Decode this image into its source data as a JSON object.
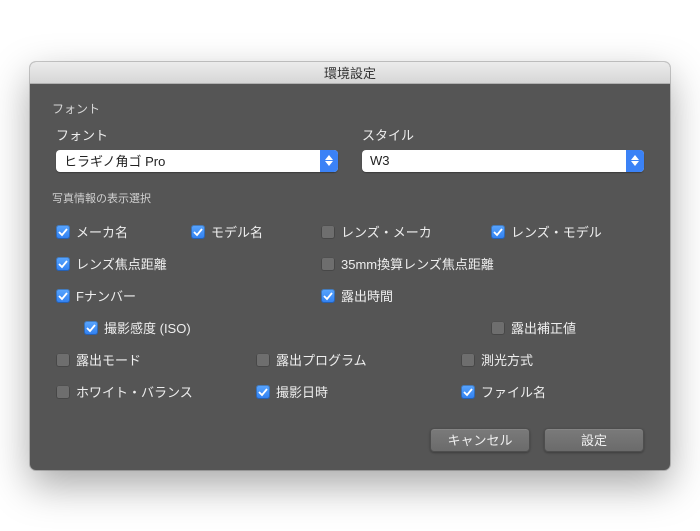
{
  "title": "環境設定",
  "fontSection": {
    "groupLabel": "フォント",
    "fontLabel": "フォント",
    "styleLabel": "スタイル",
    "fontValue": "ヒラギノ角ゴ Pro",
    "styleValue": "W3"
  },
  "displaySection": {
    "label": "写真情報の表示選択",
    "items": {
      "maker": {
        "label": "メーカ名",
        "checked": true
      },
      "model": {
        "label": "モデル名",
        "checked": true
      },
      "lensMaker": {
        "label": "レンズ・メーカ",
        "checked": false
      },
      "lensModel": {
        "label": "レンズ・モデル",
        "checked": true
      },
      "focalLength": {
        "label": "レンズ焦点距離",
        "checked": true
      },
      "focal35mm": {
        "label": "35mm換算レンズ焦点距離",
        "checked": false
      },
      "fNumber": {
        "label": "Fナンバー",
        "checked": true
      },
      "exposureTime": {
        "label": "露出時間",
        "checked": true
      },
      "iso": {
        "label": "撮影感度 (ISO)",
        "checked": true
      },
      "evBias": {
        "label": "露出補正値",
        "checked": false
      },
      "exposureMode": {
        "label": "露出モード",
        "checked": false
      },
      "exposureProgram": {
        "label": "露出プログラム",
        "checked": false
      },
      "metering": {
        "label": "測光方式",
        "checked": false
      },
      "whiteBalance": {
        "label": "ホワイト・バランス",
        "checked": false
      },
      "shotDate": {
        "label": "撮影日時",
        "checked": true
      },
      "fileName": {
        "label": "ファイル名",
        "checked": true
      }
    }
  },
  "buttons": {
    "cancel": "キャンセル",
    "ok": "設定"
  }
}
